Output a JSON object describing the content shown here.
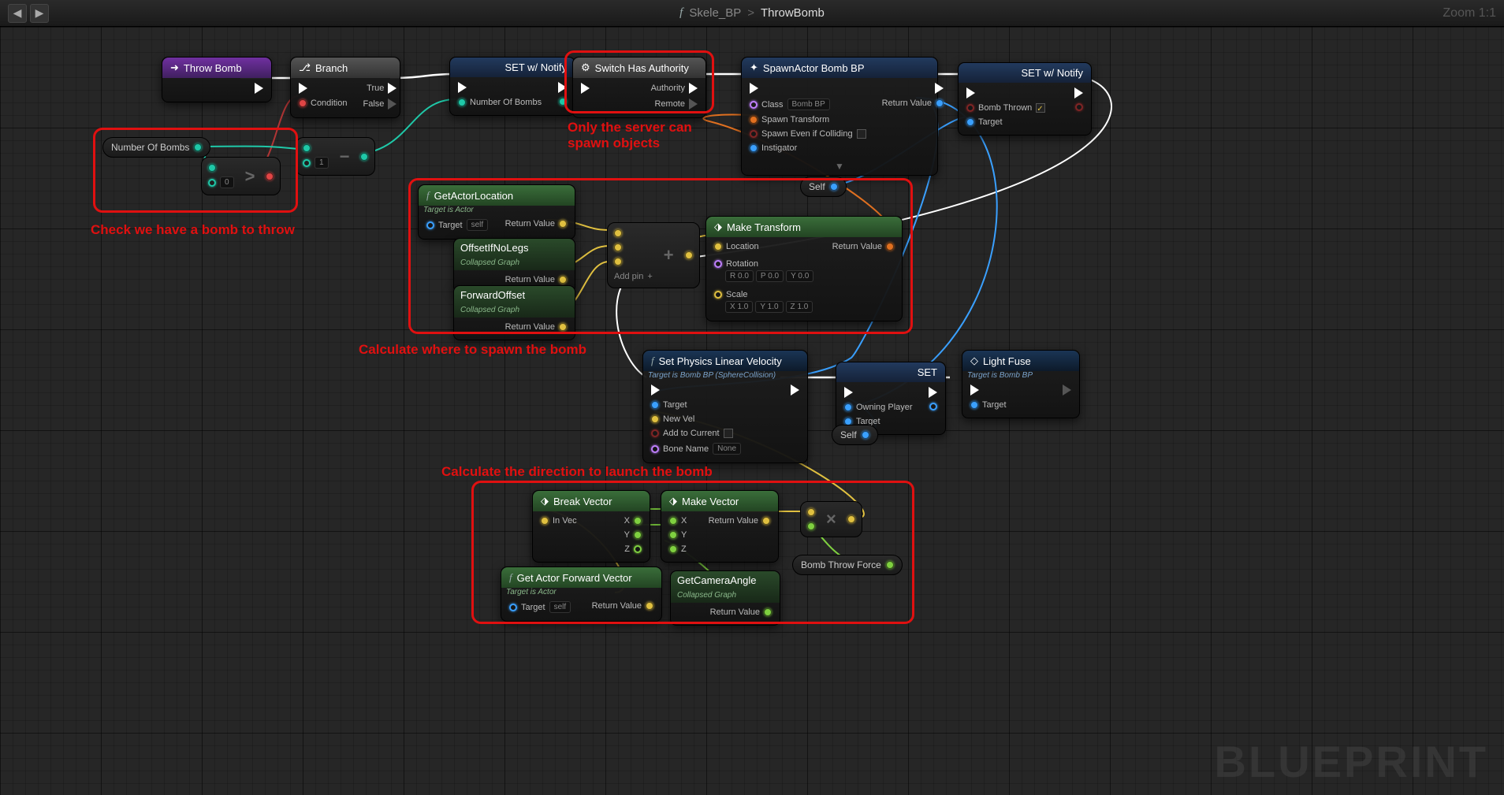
{
  "topbar": {
    "breadcrumb_blueprint": "Skele_BP",
    "breadcrumb_separator": ">",
    "breadcrumb_function": "ThrowBomb",
    "zoom": "Zoom 1:1"
  },
  "watermark": "BLUEPRINT",
  "annotations": {
    "check_bomb": "Check we have a bomb to throw",
    "server_spawn_l1": "Only the server can",
    "server_spawn_l2": "spawn objects",
    "calc_spawn": "Calculate where to spawn the bomb",
    "calc_direction": "Calculate the direction to launch the bomb"
  },
  "nodes": {
    "throw_bomb": {
      "title": "Throw Bomb"
    },
    "branch": {
      "title": "Branch",
      "condition": "Condition",
      "true": "True",
      "false": "False"
    },
    "set_notify1": {
      "title": "SET w/ Notify",
      "var": "Number Of Bombs"
    },
    "switch_auth": {
      "title": "Switch Has Authority",
      "authority": "Authority",
      "remote": "Remote"
    },
    "spawn_actor": {
      "title": "SpawnActor Bomb BP",
      "class_label": "Class",
      "class_value": "Bomb BP",
      "transform": "Spawn Transform",
      "colliding": "Spawn Even if Colliding",
      "instigator": "Instigator",
      "return": "Return Value"
    },
    "set_notify2": {
      "title": "SET w/ Notify",
      "var": "Bomb Thrown",
      "target": "Target"
    },
    "num_bombs_var": "Number Of Bombs",
    "greater": {
      "value": "0"
    },
    "minus": {
      "value": "1"
    },
    "get_actor_loc": {
      "title": "GetActorLocation",
      "sub": "Target is Actor",
      "target": "Target",
      "self": "self",
      "return": "Return Value"
    },
    "offset_nolegs": {
      "title": "OffsetIfNoLegs",
      "sub": "Collapsed Graph",
      "return": "Return Value"
    },
    "forward_offset": {
      "title": "ForwardOffset",
      "sub": "Collapsed Graph",
      "return": "Return Value"
    },
    "add_vec": {
      "addpin": "Add pin"
    },
    "make_transform": {
      "title": "Make Transform",
      "location": "Location",
      "rotation_label": "Rotation",
      "rotation": {
        "r": "R",
        "p": "P",
        "y": "Y",
        "rv": "0.0",
        "pv": "0.0",
        "yv": "0.0"
      },
      "scale_label": "Scale",
      "scale": {
        "x": "X",
        "y": "Y",
        "z": "Z",
        "xv": "1.0",
        "yv": "1.0",
        "zv": "1.0"
      },
      "return": "Return Value"
    },
    "self1": "Self",
    "set_physics": {
      "title": "Set Physics Linear Velocity",
      "sub": "Target is Bomb BP (SphereCollision)",
      "target": "Target",
      "newvel": "New Vel",
      "addcurrent": "Add to Current",
      "bonename": "Bone Name",
      "bonename_val": "None"
    },
    "set3": {
      "title": "SET",
      "owning": "Owning Player",
      "target": "Target"
    },
    "light_fuse": {
      "title": "Light Fuse",
      "sub": "Target is Bomb BP",
      "target": "Target"
    },
    "self2": "Self",
    "break_vec": {
      "title": "Break Vector",
      "invec": "In Vec",
      "x": "X",
      "y": "Y",
      "z": "Z"
    },
    "make_vec": {
      "title": "Make Vector",
      "x": "X",
      "y": "Y",
      "z": "Z",
      "return": "Return Value"
    },
    "mult": {},
    "bomb_throw_force": "Bomb Throw Force",
    "get_forward": {
      "title": "Get Actor Forward Vector",
      "sub": "Target is Actor",
      "target": "Target",
      "self": "self",
      "return": "Return Value"
    },
    "get_cam_angle": {
      "title": "GetCameraAngle",
      "sub": "Collapsed Graph",
      "return": "Return Value"
    }
  }
}
